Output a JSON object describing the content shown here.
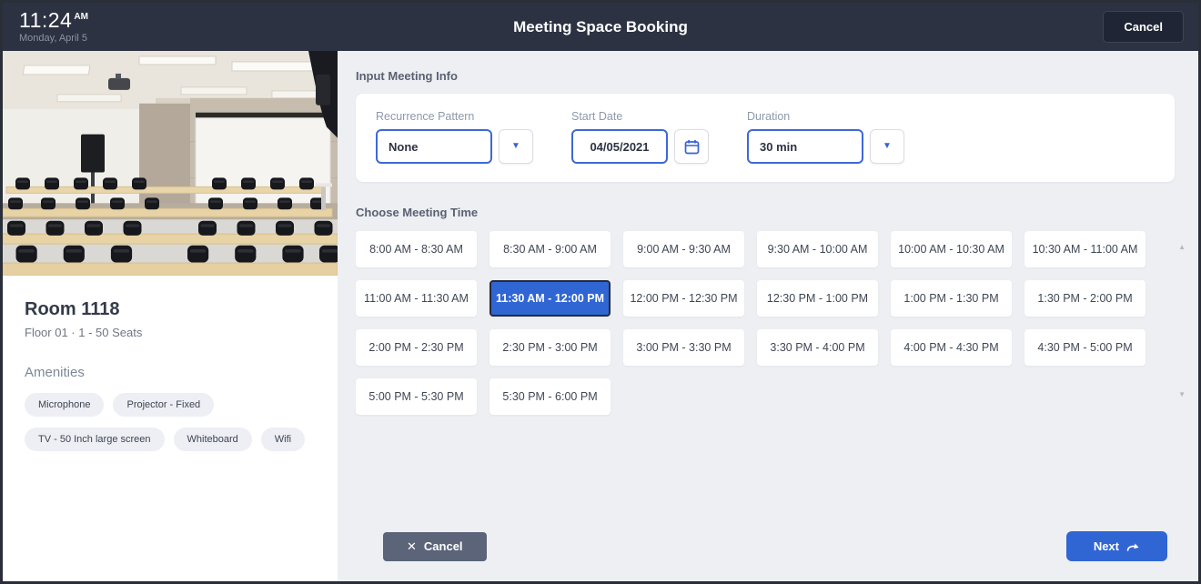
{
  "header": {
    "time": "11:24",
    "meridiem": "AM",
    "date": "Monday, April 5",
    "title": "Meeting Space Booking",
    "cancel_label": "Cancel"
  },
  "room": {
    "name": "Room 1118",
    "details": "Floor 01  ·  1 - 50 Seats",
    "amenities_label": "Amenities",
    "amenities": [
      "Microphone",
      "Projector - Fixed",
      "TV - 50 Inch large screen",
      "Whiteboard",
      "Wifi"
    ]
  },
  "form": {
    "section_label": "Input Meeting Info",
    "recurrence": {
      "label": "Recurrence Pattern",
      "value": "None"
    },
    "start_date": {
      "label": "Start Date",
      "value": "04/05/2021"
    },
    "duration": {
      "label": "Duration",
      "value": "30 min"
    }
  },
  "slots": {
    "section_label": "Choose Meeting Time",
    "selected": "11:30 AM - 12:00 PM",
    "times": [
      "8:00 AM - 8:30 AM",
      "8:30 AM - 9:00 AM",
      "9:00 AM - 9:30 AM",
      "9:30 AM - 10:00 AM",
      "10:00 AM - 10:30 AM",
      "10:30 AM - 11:00 AM",
      "11:00 AM - 11:30 AM",
      "11:30 AM - 12:00 PM",
      "12:00 PM - 12:30 PM",
      "12:30 PM - 1:00 PM",
      "1:00 PM - 1:30 PM",
      "1:30 PM - 2:00 PM",
      "2:00 PM - 2:30 PM",
      "2:30 PM - 3:00 PM",
      "3:00 PM - 3:30 PM",
      "3:30 PM - 4:00 PM",
      "4:00 PM - 4:30 PM",
      "4:30 PM - 5:00 PM",
      "5:00 PM - 5:30 PM",
      "5:30 PM - 6:00 PM"
    ]
  },
  "footer": {
    "cancel_label": "Cancel",
    "next_label": "Next"
  },
  "colors": {
    "accent": "#3065d4",
    "header_bg": "#2c3242",
    "panel_bg": "#edeff2",
    "selected_slot_border": "#252b38"
  }
}
